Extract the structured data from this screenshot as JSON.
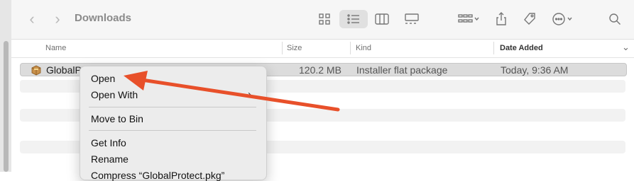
{
  "toolbar": {
    "title": "Downloads",
    "back_icon": "chevron-left-icon",
    "forward_icon": "chevron-right-icon"
  },
  "columns": {
    "name": "Name",
    "size": "Size",
    "kind": "Kind",
    "date_added": "Date Added"
  },
  "file": {
    "name": "GlobalPr",
    "size": "120.2 MB",
    "kind": "Installer flat package",
    "date_added": "Today, 9:36 AM"
  },
  "context_menu": {
    "items": [
      {
        "label": "Open"
      },
      {
        "label": "Open With"
      },
      {
        "label": "Move to Bin"
      },
      {
        "label": "Get Info"
      },
      {
        "label": "Rename"
      },
      {
        "label": "Compress “GlobalProtect.pkg”"
      }
    ]
  },
  "colors": {
    "arrow": "#e8502a",
    "selected_row": "#dcdcdc",
    "menu_bg": "#ececec"
  }
}
